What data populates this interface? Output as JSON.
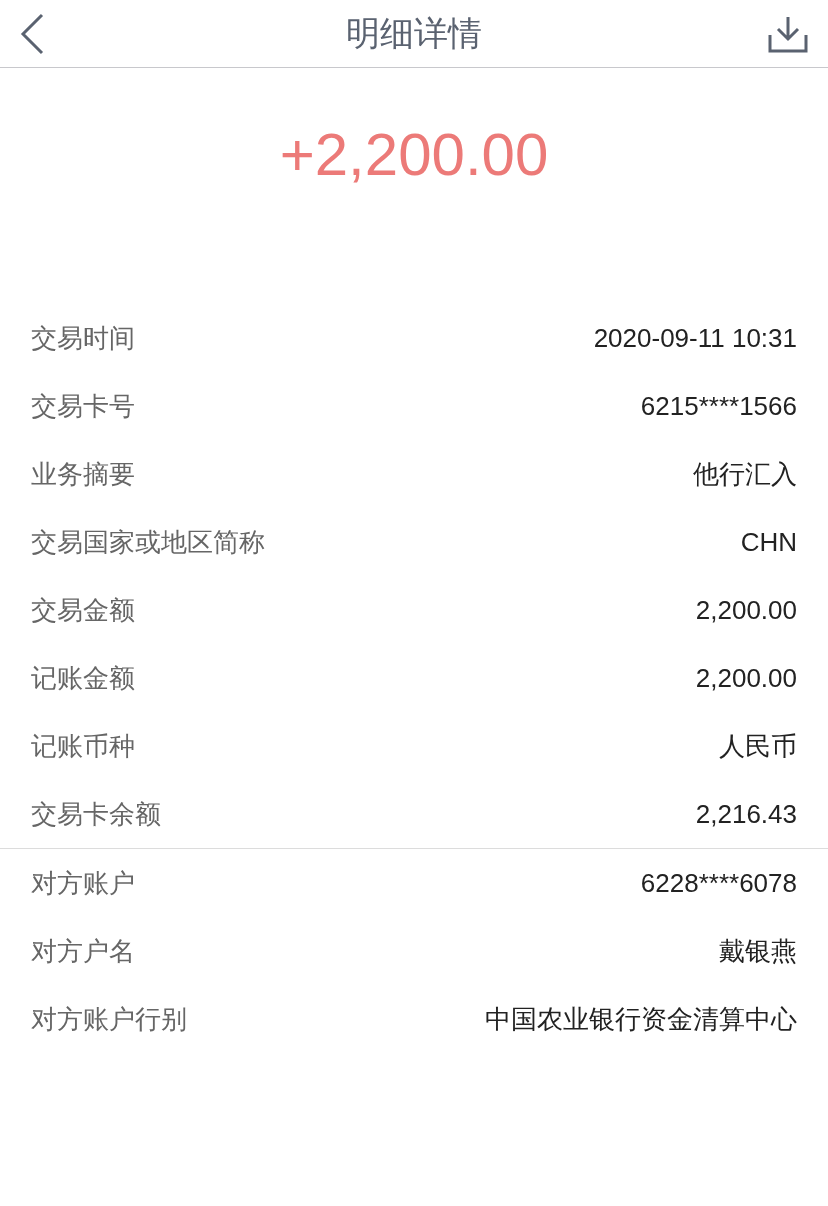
{
  "header": {
    "title": "明细详情"
  },
  "amount": "+2,200.00",
  "sections": [
    {
      "rows": [
        {
          "label": "交易时间",
          "value": "2020-09-11 10:31"
        },
        {
          "label": "交易卡号",
          "value": "6215****1566"
        },
        {
          "label": "业务摘要",
          "value": "他行汇入"
        },
        {
          "label": "交易国家或地区简称",
          "value": "CHN"
        },
        {
          "label": "交易金额",
          "value": "2,200.00"
        },
        {
          "label": "记账金额",
          "value": "2,200.00"
        },
        {
          "label": "记账币种",
          "value": "人民币"
        },
        {
          "label": "交易卡余额",
          "value": "2,216.43"
        }
      ]
    },
    {
      "rows": [
        {
          "label": "对方账户",
          "value": "6228****6078"
        },
        {
          "label": "对方户名",
          "value": "戴银燕"
        },
        {
          "label": "对方账户行别",
          "value": "中国农业银行资金清算中心"
        }
      ]
    }
  ]
}
